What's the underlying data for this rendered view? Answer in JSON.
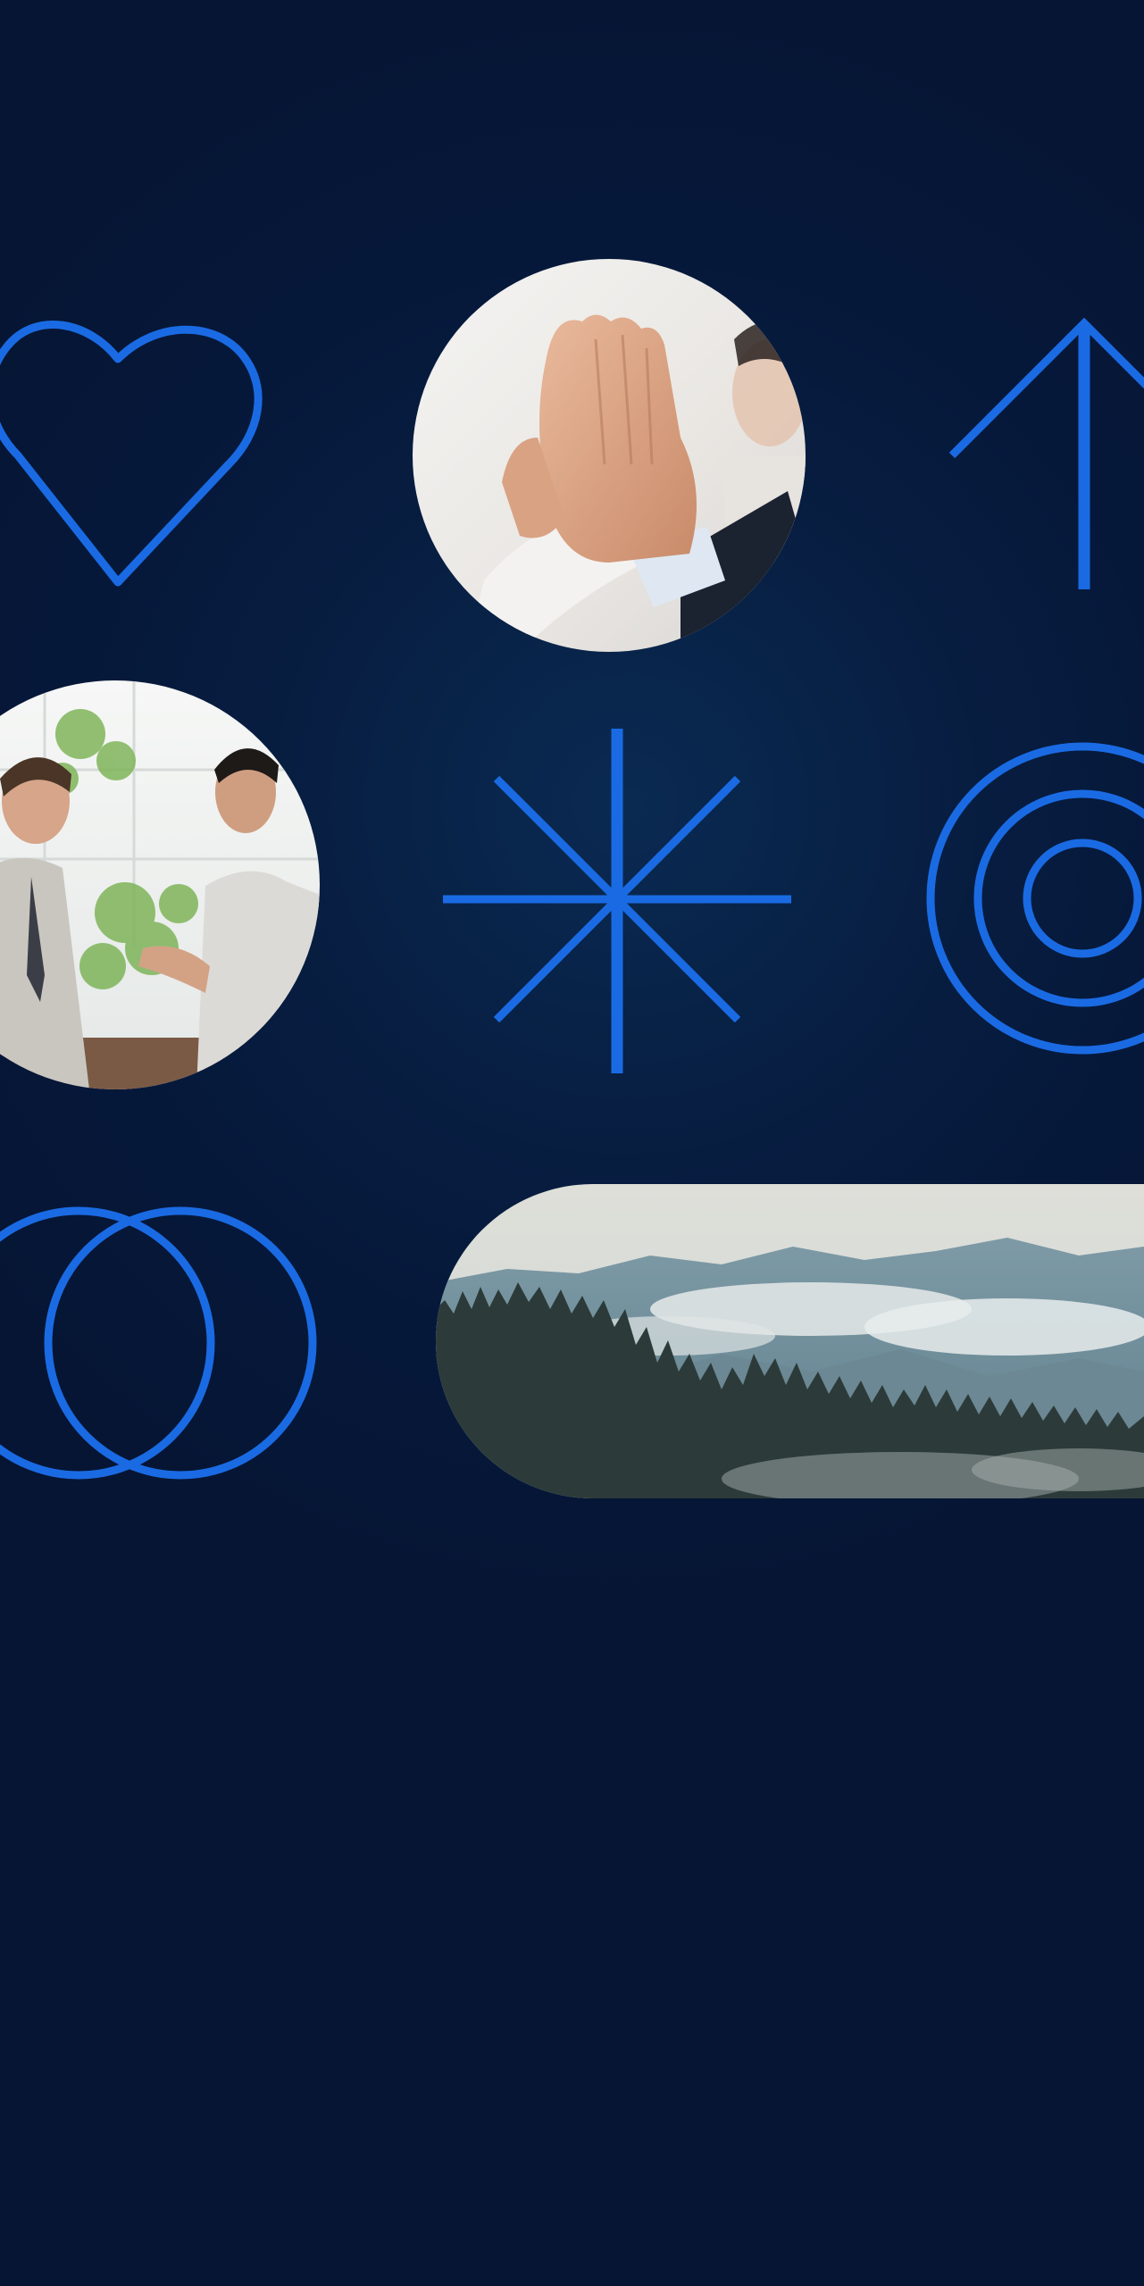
{
  "theme": {
    "background": "#061838",
    "accent": "#1a6be3"
  },
  "tiles": [
    {
      "kind": "icon",
      "icon": "heart-outline-icon"
    },
    {
      "kind": "photo",
      "subject": "high-five-hands-photo"
    },
    {
      "kind": "icon",
      "icon": "arrow-up-icon"
    },
    {
      "kind": "photo",
      "subject": "two-businessmen-talking-photo"
    },
    {
      "kind": "icon",
      "icon": "asterisk-burst-icon"
    },
    {
      "kind": "icon",
      "icon": "concentric-circles-icon"
    },
    {
      "kind": "icon",
      "icon": "overlapping-rings-icon"
    },
    {
      "kind": "photo",
      "subject": "misty-mountain-forest-photo"
    }
  ]
}
